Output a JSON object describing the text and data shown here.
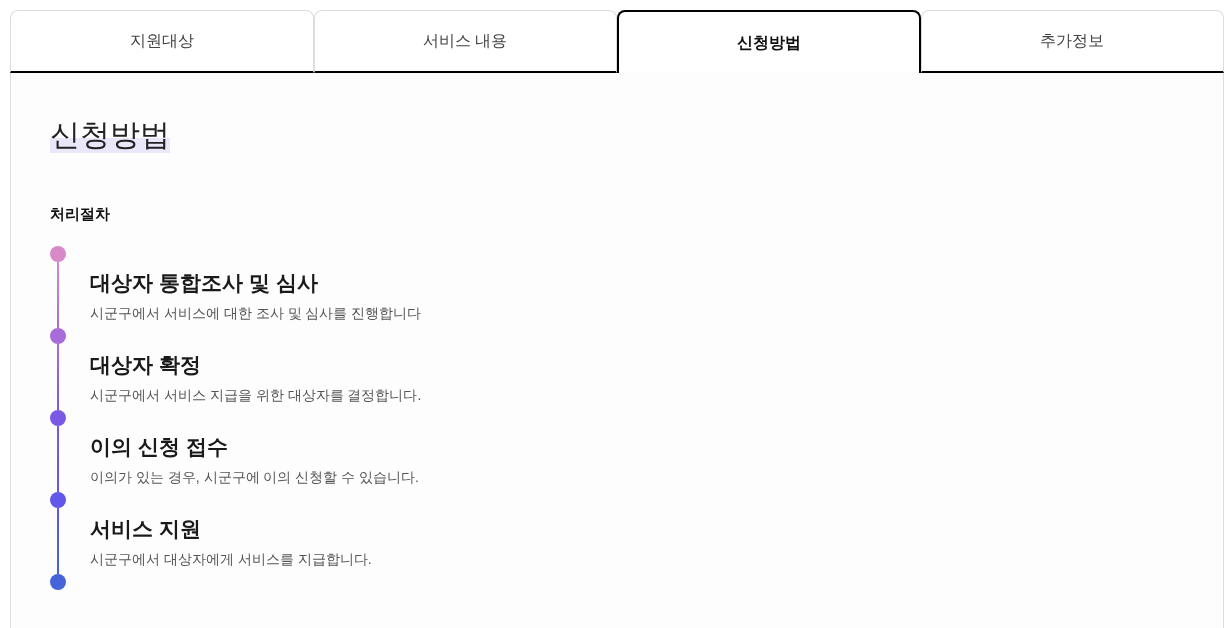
{
  "tabs": [
    {
      "label": "지원대상",
      "selected": false
    },
    {
      "label": "서비스 내용",
      "selected": false
    },
    {
      "label": "신청방법",
      "selected": true
    },
    {
      "label": "추가정보",
      "selected": false
    }
  ],
  "section": {
    "title": "신청방법",
    "subtitle": "처리절차"
  },
  "timeline": {
    "dots": [
      {
        "color": "#d88ac8"
      },
      {
        "color": "#a66cd9"
      },
      {
        "color": "#7a5ae4"
      },
      {
        "color": "#6157e8"
      },
      {
        "color": "#4464d8"
      }
    ],
    "steps": [
      {
        "title": "대상자 통합조사 및 심사",
        "description": "시군구에서 서비스에 대한 조사 및 심사를 진행합니다"
      },
      {
        "title": "대상자 확정",
        "description": "시군구에서 서비스 지급을 위한 대상자를 결정합니다."
      },
      {
        "title": "이의 신청 접수",
        "description": "이의가 있는 경우, 시군구에 이의 신청할 수 있습니다."
      },
      {
        "title": "서비스 지원",
        "description": "시군구에서 대상자에게 서비스를 지급합니다."
      }
    ]
  }
}
